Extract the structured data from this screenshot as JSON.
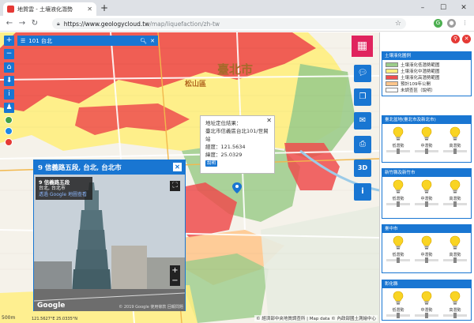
{
  "browser": {
    "tab_title": "地質雲 - 土壤液化潛勢",
    "url_host": "https://www.geologycloud.tw",
    "url_path": "/map/liquefaction/zh-tw",
    "new_tab": "+",
    "win_min": "–",
    "win_max": "☐",
    "win_close": "✕"
  },
  "search": {
    "value": "101 台北"
  },
  "map": {
    "city_label": "臺北市",
    "district_label": "松山區",
    "scale_label": "500m",
    "coord_text": "121.5627°E 25.0335°N",
    "attribution": "© 經濟部中央地質調查所 | Map data © 內政部國土測繪中心"
  },
  "popup": {
    "line1": "地址定位結果：",
    "line2": "臺北市信義區台北101/世貿站",
    "line3": "經度：121.5634",
    "line4": "緯度：25.0329",
    "tag": "說明"
  },
  "streetview": {
    "header": "9 信義路五段, 台北, 台北市",
    "info_title": "9 信義路五段",
    "info_sub": "台北, 台北市",
    "info_link": "透過 Google 地圖查看",
    "google": "Google",
    "copyright": "© 2019 Google  使用條款  回報問題"
  },
  "panel": {
    "legend_title": "土壤液化圖例",
    "legend": [
      {
        "label": "土壤液化低潛勢範圍",
        "color": "#9ccc8b"
      },
      {
        "label": "土壤液化中潛勢範圍",
        "color": "#ffee80"
      },
      {
        "label": "土壤液化高潛勢範圍",
        "color": "#ee4e4e"
      },
      {
        "label": "預計109年公開",
        "color": "#ffc58a"
      },
      {
        "label": "未調查區（說明）",
        "color": "#ffffff"
      }
    ],
    "regions": [
      {
        "title": "臺北盆地(臺北市及新北市)",
        "bulbs": [
          "低潛勢",
          "中潛勢",
          "高潛勢"
        ]
      },
      {
        "title": "新竹縣及新竹市",
        "bulbs": [
          "低潛勢",
          "中潛勢",
          "高潛勢"
        ]
      },
      {
        "title": "臺中市",
        "bulbs": [
          "低潛勢",
          "中潛勢",
          "高潛勢"
        ]
      },
      {
        "title": "彰化縣",
        "bulbs": [
          "低潛勢",
          "中潛勢",
          "高潛勢"
        ]
      }
    ]
  },
  "colors": {
    "primary": "#1976d2",
    "high": "#ee4e4e",
    "mid": "#ffee80",
    "low": "#9ccc8b",
    "accent_pink": "#e0245e"
  }
}
